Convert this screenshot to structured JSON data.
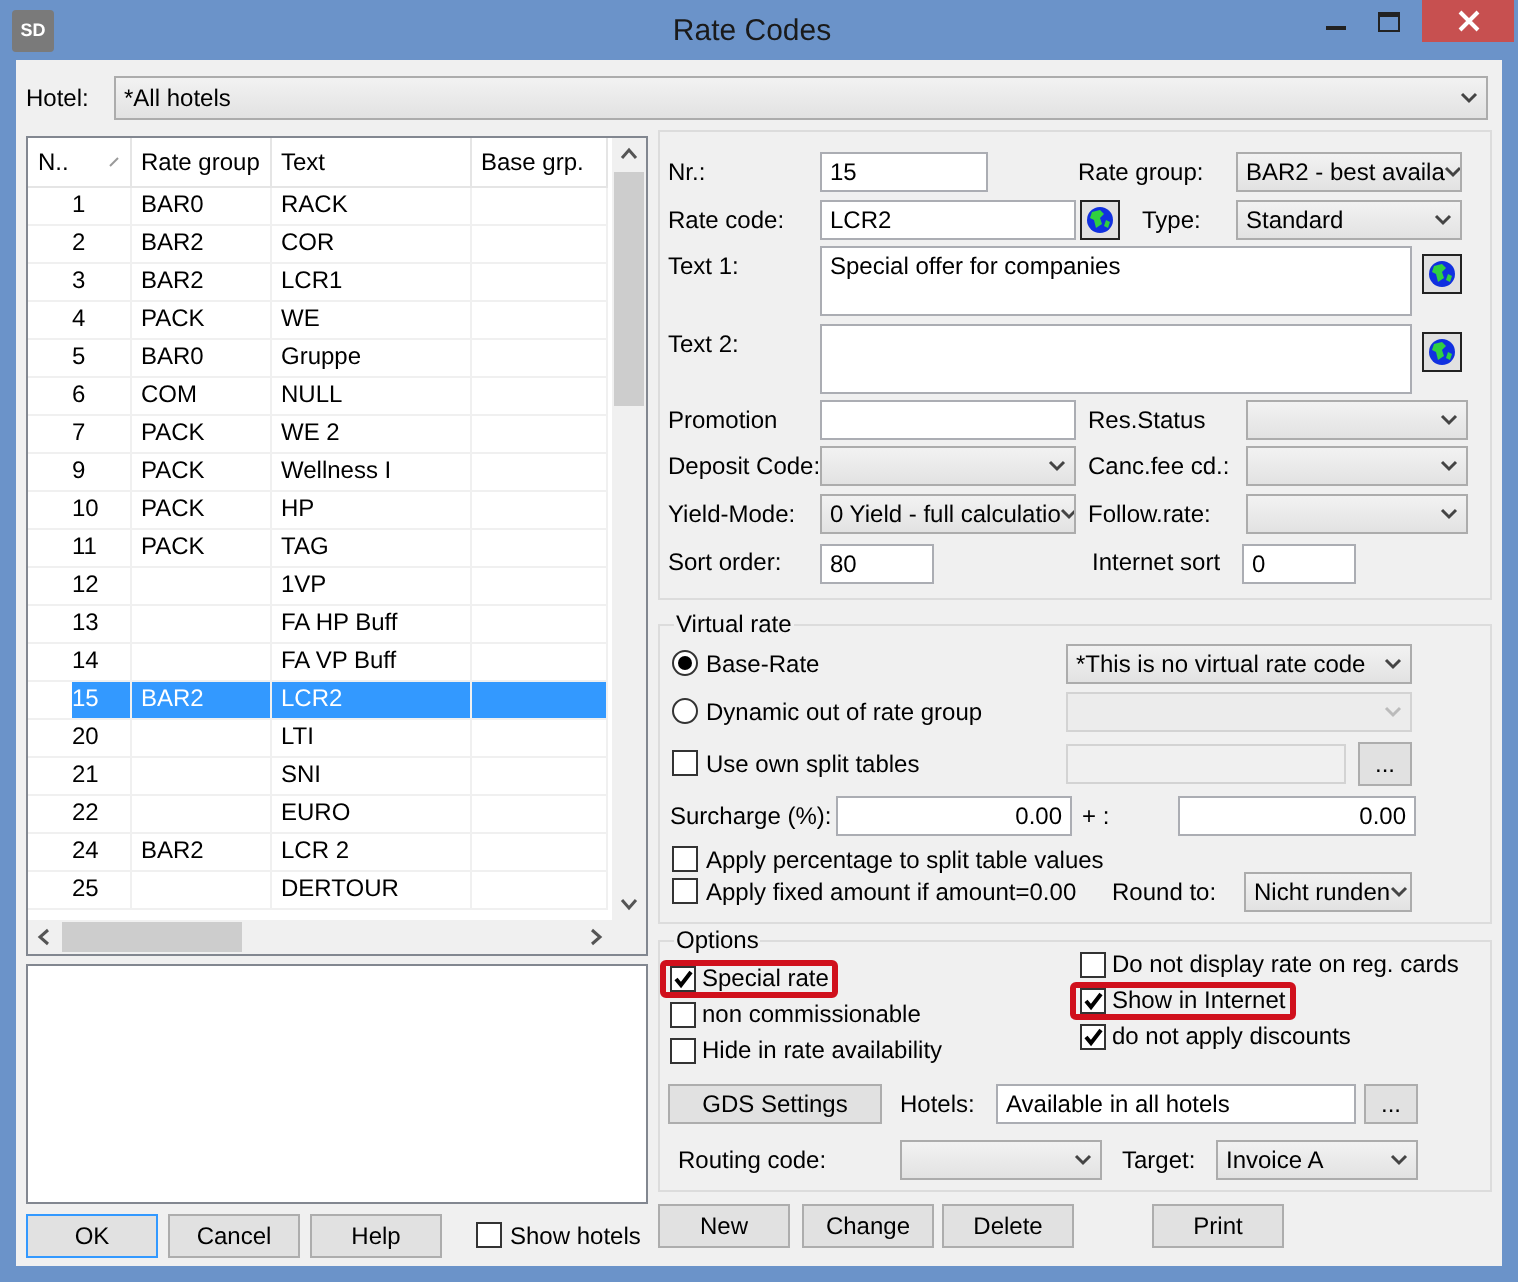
{
  "window": {
    "title": "Rate Codes",
    "app_icon_text": "SD"
  },
  "hotel": {
    "label": "Hotel:",
    "value": "*All hotels"
  },
  "table": {
    "columns": [
      "N..",
      "Rate group",
      "Text",
      "Base grp."
    ],
    "rows": [
      {
        "nr": "1",
        "rate_group": "BAR0",
        "text": "RACK",
        "selected": false
      },
      {
        "nr": "2",
        "rate_group": "BAR2",
        "text": "COR",
        "selected": false
      },
      {
        "nr": "3",
        "rate_group": "BAR2",
        "text": "LCR1",
        "selected": false
      },
      {
        "nr": "4",
        "rate_group": "PACK",
        "text": "WE",
        "selected": false
      },
      {
        "nr": "5",
        "rate_group": "BAR0",
        "text": "Gruppe",
        "selected": false
      },
      {
        "nr": "6",
        "rate_group": "COM",
        "text": "NULL",
        "selected": false
      },
      {
        "nr": "7",
        "rate_group": "PACK",
        "text": "WE 2",
        "selected": false
      },
      {
        "nr": "9",
        "rate_group": "PACK",
        "text": "Wellness I",
        "selected": false
      },
      {
        "nr": "10",
        "rate_group": "PACK",
        "text": "HP",
        "selected": false
      },
      {
        "nr": "11",
        "rate_group": "PACK",
        "text": "TAG",
        "selected": false
      },
      {
        "nr": "12",
        "text": "1VP",
        "selected": false
      },
      {
        "nr": "13",
        "text": "FA HP Buff",
        "selected": false
      },
      {
        "nr": "14",
        "text": "FA VP Buff",
        "selected": false
      },
      {
        "nr": "15",
        "rate_group": "BAR2",
        "text": "LCR2",
        "selected": true
      },
      {
        "nr": "20",
        "text": "LTI",
        "selected": false
      },
      {
        "nr": "21",
        "text": "SNI",
        "selected": false
      },
      {
        "nr": "22",
        "text": "EURO",
        "selected": false
      },
      {
        "nr": "24",
        "rate_group": "BAR2",
        "text": "LCR 2",
        "selected": false
      },
      {
        "nr": "25",
        "text": "DERTOUR",
        "selected": false
      }
    ]
  },
  "left_buttons": [
    "OK",
    "Cancel",
    "Help"
  ],
  "show_hotels": {
    "label": "Show hotels",
    "checked": false
  },
  "form": {
    "nr": {
      "label": "Nr.:",
      "value": "15"
    },
    "rate_group": {
      "label": "Rate group:",
      "value": "BAR2  - best availa"
    },
    "rate_code": {
      "label": "Rate code:",
      "value": "LCR2"
    },
    "type": {
      "label": "Type:",
      "value": "Standard"
    },
    "text1": {
      "label": "Text 1:",
      "value": "Special offer for companies"
    },
    "text2": {
      "label": "Text 2:"
    },
    "promotion": {
      "label": "Promotion"
    },
    "res_status": {
      "label": "Res.Status"
    },
    "deposit_code": {
      "label": "Deposit Code:"
    },
    "canc_fee": {
      "label": "Canc.fee cd.:"
    },
    "yield_mode": {
      "label": "Yield-Mode:",
      "value": "0 Yield - full calculatio"
    },
    "follow_rate": {
      "label": "Follow.rate:"
    },
    "sort_order": {
      "label": "Sort order:",
      "value": "80"
    },
    "internet_sort": {
      "label": "Internet sort",
      "value": "0"
    }
  },
  "virtual_rate": {
    "title": "Virtual rate",
    "radios": [
      {
        "label": "Base-Rate",
        "selected": true
      },
      {
        "label": "Dynamic out of rate group",
        "selected": false
      }
    ],
    "base_select": "*This is no virtual rate code",
    "use_split": {
      "label": "Use own split tables",
      "checked": false
    },
    "browse_button": "...",
    "surcharge": {
      "label": "Surcharge (%):",
      "value": "0.00"
    },
    "plus": {
      "label": "+ :",
      "value": "0.00"
    },
    "apply_percentage": {
      "label": "Apply percentage to split table values",
      "checked": false
    },
    "apply_fixed": {
      "label": "Apply fixed amount if amount=0.00",
      "checked": false
    },
    "round_to": {
      "label": "Round to:",
      "value": "Nicht runden"
    }
  },
  "options": {
    "title": "Options",
    "left": [
      {
        "label": "Special rate",
        "checked": true,
        "highlighted": true
      },
      {
        "label": "non commissionable",
        "checked": false,
        "highlighted": false
      },
      {
        "label": "Hide in rate availability",
        "checked": false,
        "highlighted": false
      }
    ],
    "right": [
      {
        "label": "Do not display rate on reg. cards",
        "checked": false,
        "highlighted": false
      },
      {
        "label": "Show in Internet",
        "checked": true,
        "highlighted": true
      },
      {
        "label": "do not apply discounts",
        "checked": true,
        "highlighted": false
      }
    ],
    "gds_button": "GDS Settings",
    "hotels": {
      "label": "Hotels:",
      "value": "Available in all hotels",
      "button": "..."
    },
    "routing": {
      "label": "Routing code:"
    },
    "target": {
      "label": "Target:",
      "value": "Invoice A"
    }
  },
  "actions": [
    "New",
    "Change",
    "Delete",
    "Print"
  ]
}
